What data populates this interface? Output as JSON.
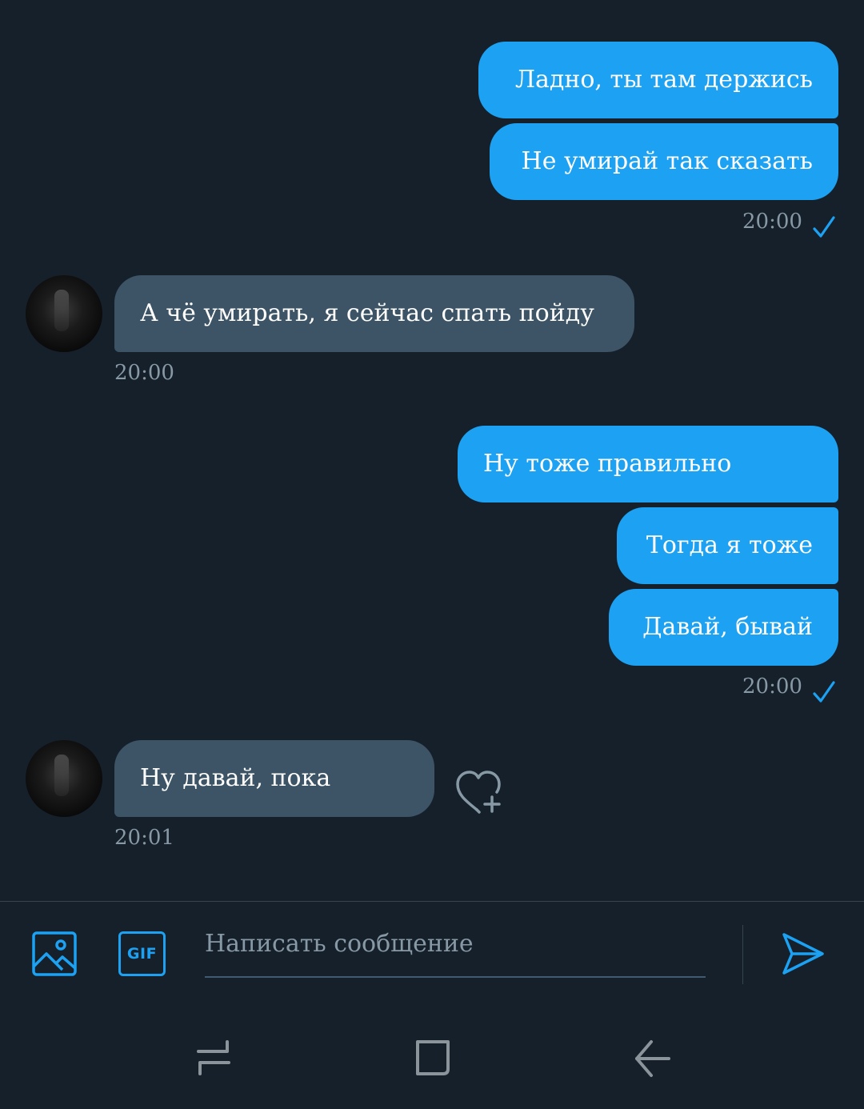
{
  "messages": [
    {
      "text": "Ладно, ты там держись"
    },
    {
      "text": "Не умирай так сказать"
    },
    {
      "text": "А чё умирать, я сейчас спать пойду"
    },
    {
      "text": "Ну тоже правильно"
    },
    {
      "text": "Тогда я тоже"
    },
    {
      "text": "Давай, бывай"
    },
    {
      "text": "Ну давай, пока"
    }
  ],
  "timestamps": {
    "out1": "20:00",
    "in1": "20:00",
    "out2": "20:00",
    "in2": "20:01"
  },
  "composer": {
    "placeholder": "Написать сообщение",
    "gif_label": "GIF"
  },
  "icons": {
    "image": "image-icon",
    "gif": "gif-icon",
    "send": "send-icon",
    "like": "heart-plus-icon",
    "check": "checkmark-icon",
    "nav_recent": "recent-apps-icon",
    "nav_home": "home-icon",
    "nav_back": "back-icon"
  },
  "colors": {
    "background": "#15202b",
    "outgoing_bubble": "#1da1f2",
    "incoming_bubble": "#3d5466",
    "muted_text": "#8899a6"
  }
}
